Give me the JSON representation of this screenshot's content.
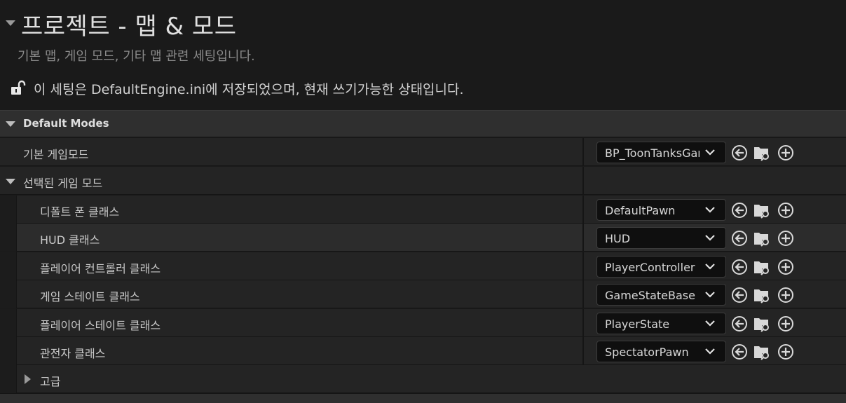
{
  "header": {
    "title": "프로젝트 - 맵 & 모드",
    "subtitle": "기본 맵, 게임 모드, 기타 맵 관련 세팅입니다.",
    "notice": "이 세팅은 DefaultEngine.ini에 저장되었으며, 현재 쓰기가능한 상태입니다."
  },
  "section": {
    "label": "Default Modes"
  },
  "default_gamemode": {
    "label": "기본 게임모드",
    "value": "BP_ToonTanksGameMode"
  },
  "selected_gamemode": {
    "label": "선택된 게임 모드"
  },
  "class_rows": [
    {
      "label": "디폴트 폰 클래스",
      "value": "DefaultPawn"
    },
    {
      "label": "HUD 클래스",
      "value": "HUD"
    },
    {
      "label": "플레이어 컨트롤러 클래스",
      "value": "PlayerController"
    },
    {
      "label": "게임 스테이트 클래스",
      "value": "GameStateBase"
    },
    {
      "label": "플레이어 스테이트 클래스",
      "value": "PlayerState"
    },
    {
      "label": "관전자 클래스",
      "value": "SpectatorPawn"
    }
  ],
  "advanced": {
    "label": "고급"
  },
  "icons": [
    "lock-open-icon",
    "chevron-down-icon",
    "use-selected-arrow-icon",
    "browse-folder-icon",
    "add-plus-icon"
  ],
  "colors": {
    "background": "#1a1a1a",
    "row": "#242424",
    "section": "#2f2f2f",
    "combo": "#0f0f0f",
    "text": "#c8c8c8"
  }
}
